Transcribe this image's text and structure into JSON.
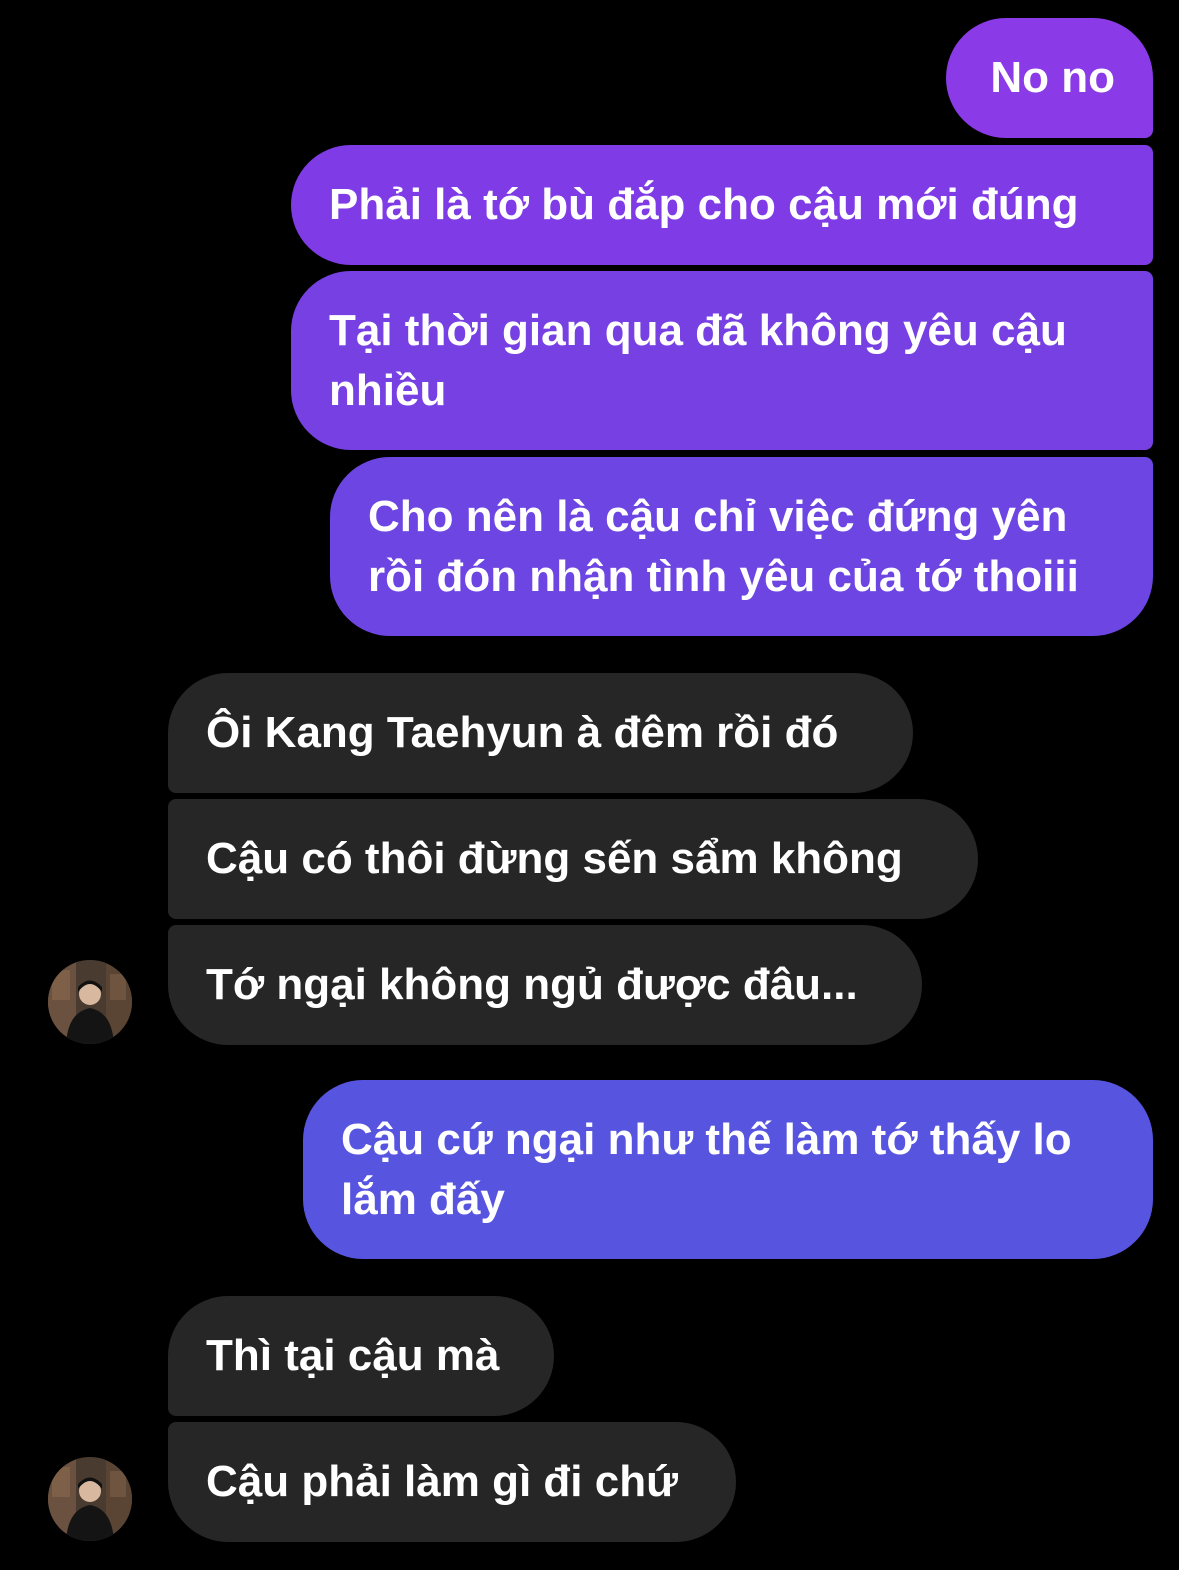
{
  "chat": {
    "messages": [
      {
        "from": "me",
        "text": "No no"
      },
      {
        "from": "me",
        "text": "Phải là tớ bù đắp cho cậu mới đúng"
      },
      {
        "from": "me",
        "text": "Tại thời gian qua đã không yêu cậu nhiều"
      },
      {
        "from": "me",
        "text": "Cho nên là cậu chỉ việc đứng yên rồi đón nhận tình yêu của tớ thoiii"
      },
      {
        "from": "them",
        "text": "Ôi Kang Taehyun à đêm rồi đó"
      },
      {
        "from": "them",
        "text": "Cậu có thôi đừng sến sẩm không"
      },
      {
        "from": "them",
        "text": "Tớ ngại không ngủ được đâu..."
      },
      {
        "from": "me",
        "text": "Cậu cứ ngại như thế làm tớ thấy lo lắm đấy"
      },
      {
        "from": "them",
        "text": "Thì tại cậu mà"
      },
      {
        "from": "them",
        "text": "Cậu phải làm gì đi chứ"
      }
    ]
  },
  "colors": {
    "background": "#000000",
    "incoming_bubble": "#262626",
    "outgoing_top": "#8a3ae6",
    "outgoing_bottom": "#5755e0",
    "text": "#ffffff"
  },
  "icons": {
    "avatar": "contact-avatar-photo"
  }
}
